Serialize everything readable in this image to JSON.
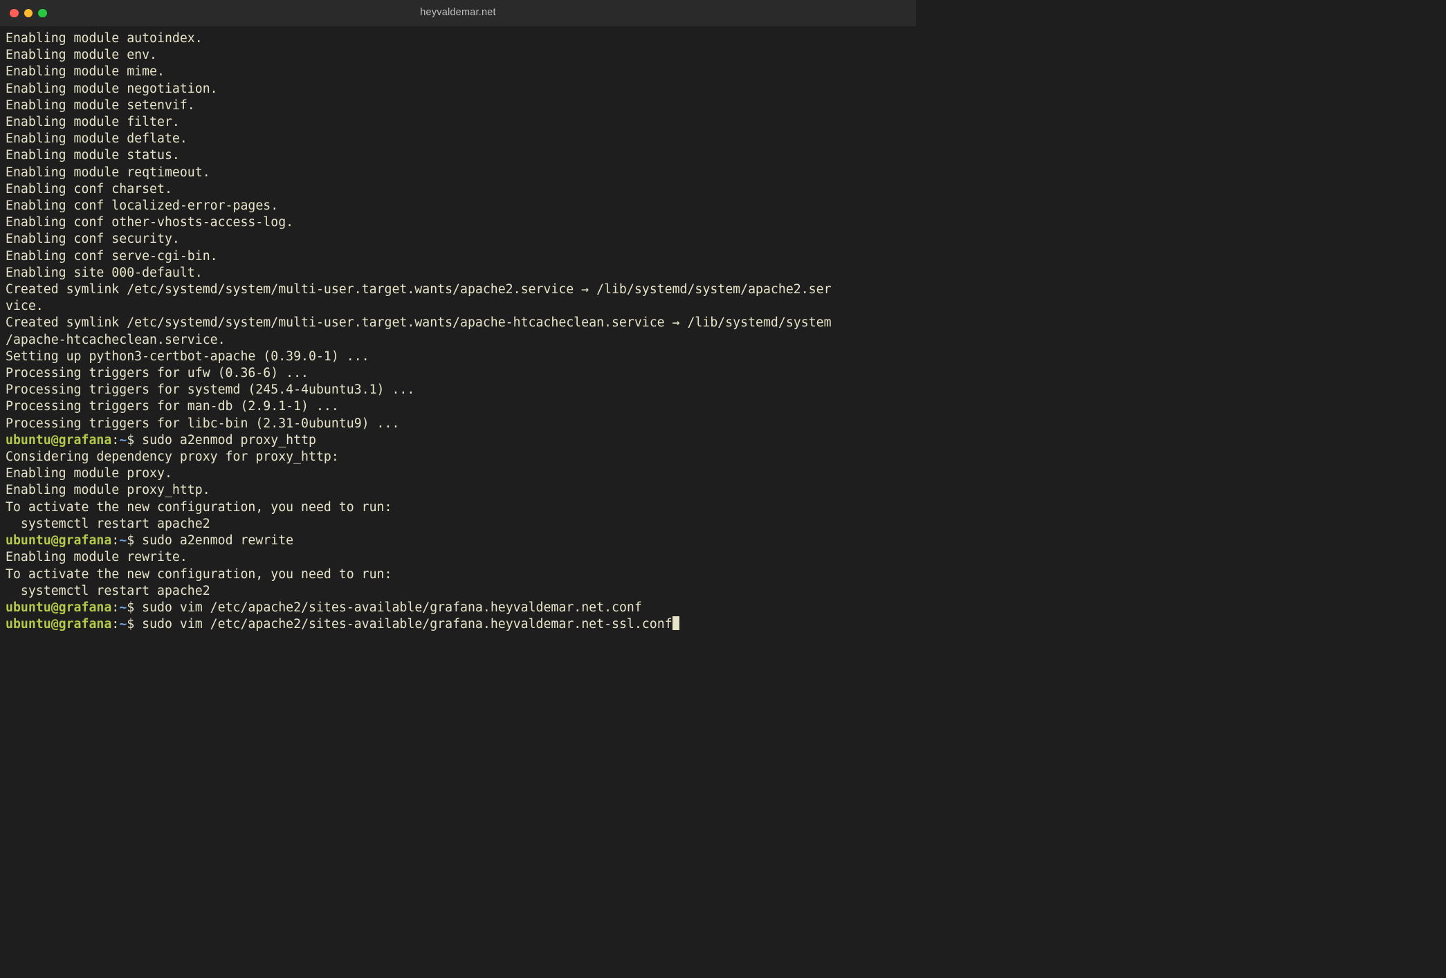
{
  "window": {
    "title": "heyvaldemar.net"
  },
  "output": [
    "Enabling module autoindex.",
    "Enabling module env.",
    "Enabling module mime.",
    "Enabling module negotiation.",
    "Enabling module setenvif.",
    "Enabling module filter.",
    "Enabling module deflate.",
    "Enabling module status.",
    "Enabling module reqtimeout.",
    "Enabling conf charset.",
    "Enabling conf localized-error-pages.",
    "Enabling conf other-vhosts-access-log.",
    "Enabling conf security.",
    "Enabling conf serve-cgi-bin.",
    "Enabling site 000-default.",
    "Created symlink /etc/systemd/system/multi-user.target.wants/apache2.service → /lib/systemd/system/apache2.service.",
    "Created symlink /etc/systemd/system/multi-user.target.wants/apache-htcacheclean.service → /lib/systemd/system/apache-htcacheclean.service.",
    "Setting up python3-certbot-apache (0.39.0-1) ...",
    "Processing triggers for ufw (0.36-6) ...",
    "Processing triggers for systemd (245.4-4ubuntu3.1) ...",
    "Processing triggers for man-db (2.9.1-1) ...",
    "Processing triggers for libc-bin (2.31-0ubuntu9) ..."
  ],
  "prompts": [
    {
      "user": "ubuntu",
      "host": "grafana",
      "path": "~",
      "command": "sudo a2enmod proxy_http",
      "after": [
        "Considering dependency proxy for proxy_http:",
        "Enabling module proxy.",
        "Enabling module proxy_http.",
        "To activate the new configuration, you need to run:",
        "  systemctl restart apache2"
      ]
    },
    {
      "user": "ubuntu",
      "host": "grafana",
      "path": "~",
      "command": "sudo a2enmod rewrite",
      "after": [
        "Enabling module rewrite.",
        "To activate the new configuration, you need to run:",
        "  systemctl restart apache2"
      ]
    },
    {
      "user": "ubuntu",
      "host": "grafana",
      "path": "~",
      "command": "sudo vim /etc/apache2/sites-available/grafana.heyvaldemar.net.conf",
      "after": []
    },
    {
      "user": "ubuntu",
      "host": "grafana",
      "path": "~",
      "command": "sudo vim /etc/apache2/sites-available/grafana.heyvaldemar.net-ssl.conf",
      "after": [],
      "cursor": true
    }
  ]
}
